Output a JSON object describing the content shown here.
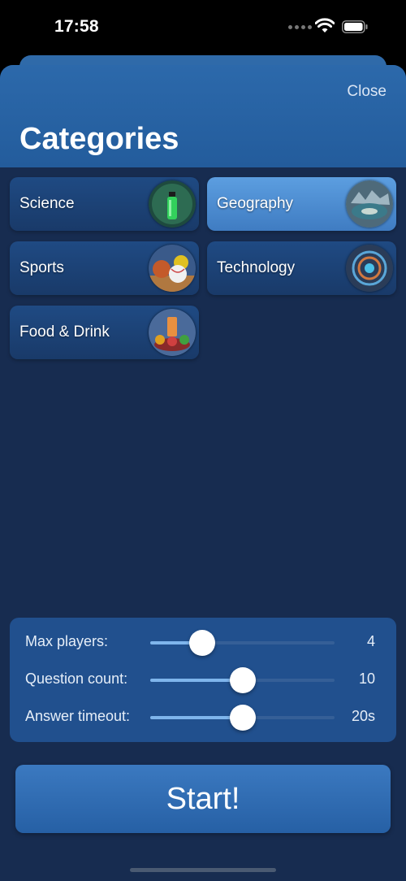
{
  "status": {
    "time": "17:58"
  },
  "header": {
    "close_label": "Close",
    "title": "Categories"
  },
  "categories": [
    {
      "label": "Science",
      "selected": false,
      "icon": "science-flask-icon"
    },
    {
      "label": "Geography",
      "selected": true,
      "icon": "geography-landscape-icon"
    },
    {
      "label": "Sports",
      "selected": false,
      "icon": "sports-balls-icon"
    },
    {
      "label": "Technology",
      "selected": false,
      "icon": "technology-circuit-icon"
    },
    {
      "label": "Food & Drink",
      "selected": false,
      "icon": "food-drink-icon"
    }
  ],
  "settings": {
    "max_players": {
      "label": "Max players:",
      "value": "4",
      "fraction": 0.28
    },
    "question_count": {
      "label": "Question count:",
      "value": "10",
      "fraction": 0.5
    },
    "answer_timeout": {
      "label": "Answer timeout:",
      "value": "20s",
      "fraction": 0.5
    }
  },
  "start_label": "Start!",
  "colors": {
    "header": "#2c69ab",
    "sheet": "#172c50",
    "card": "#1f4a83",
    "card_selected": "#5c9ee0",
    "accent": "#7fb5ec"
  }
}
